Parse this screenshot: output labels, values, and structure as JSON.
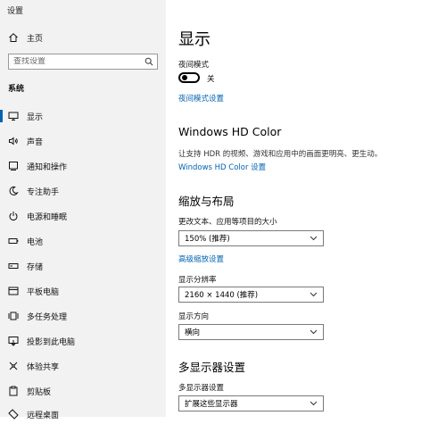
{
  "window": {
    "title": "设置"
  },
  "sidebar": {
    "home_label": "主页",
    "search_placeholder": "查找设置",
    "section_label": "系统",
    "items": [
      {
        "label": "显示",
        "icon": "monitor-icon",
        "active": true
      },
      {
        "label": "声音",
        "icon": "speaker-icon"
      },
      {
        "label": "通知和操作",
        "icon": "notification-icon"
      },
      {
        "label": "专注助手",
        "icon": "moon-icon"
      },
      {
        "label": "电源和睡眠",
        "icon": "power-icon"
      },
      {
        "label": "电池",
        "icon": "battery-icon"
      },
      {
        "label": "存储",
        "icon": "storage-icon"
      },
      {
        "label": "平板电脑",
        "icon": "tablet-icon"
      },
      {
        "label": "多任务处理",
        "icon": "multitask-icon"
      },
      {
        "label": "投影到此电脑",
        "icon": "projection-icon"
      },
      {
        "label": "体验共享",
        "icon": "share-icon"
      },
      {
        "label": "剪贴板",
        "icon": "clipboard-icon"
      },
      {
        "label": "远程桌面",
        "icon": "remote-desktop-icon"
      }
    ]
  },
  "main": {
    "title": "显示",
    "night_light": {
      "label": "夜间模式",
      "toggle_state": "关",
      "settings_link": "夜间模式设置"
    },
    "hd_color": {
      "heading": "Windows HD Color",
      "description": "让支持 HDR 的视频、游戏和应用中的画面更明亮、更生动。",
      "link": "Windows HD Color 设置"
    },
    "scale_layout": {
      "heading": "缩放与布局",
      "scale_label": "更改文本、应用等项目的大小",
      "scale_value": "150% (推荐)",
      "advanced_link": "高级缩放设置",
      "resolution_label": "显示分辨率",
      "resolution_value": "2160 × 1440 (推荐)",
      "orientation_label": "显示方向",
      "orientation_value": "横向"
    },
    "multi_display": {
      "heading": "多显示器设置",
      "label": "多显示器设置",
      "value": "扩展这些显示器"
    }
  }
}
